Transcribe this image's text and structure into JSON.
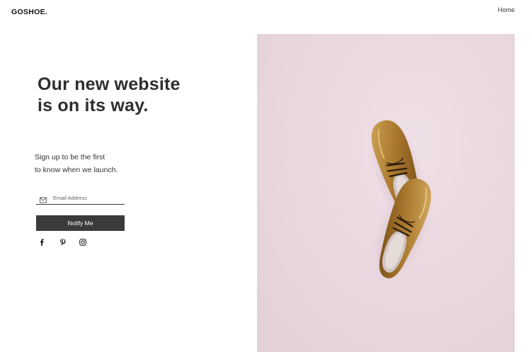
{
  "header": {
    "logo": "GOSHOE.",
    "nav": {
      "home_label": "Home"
    }
  },
  "main": {
    "headline": "Our new website is on its way.",
    "subtext_line1": "Sign up to be the first",
    "subtext_line2": "to know when we launch.",
    "form": {
      "email_placeholder": "Email Address",
      "email_value": "",
      "submit_label": "Notify Me"
    },
    "social": [
      {
        "name": "facebook-icon"
      },
      {
        "name": "pinterest-icon"
      },
      {
        "name": "instagram-icon"
      }
    ]
  },
  "hero": {
    "image": "pair of gold metallic leather oxford shoes on pink background",
    "background_color": "#e9d6de",
    "shoe_color": "#a8772c"
  }
}
